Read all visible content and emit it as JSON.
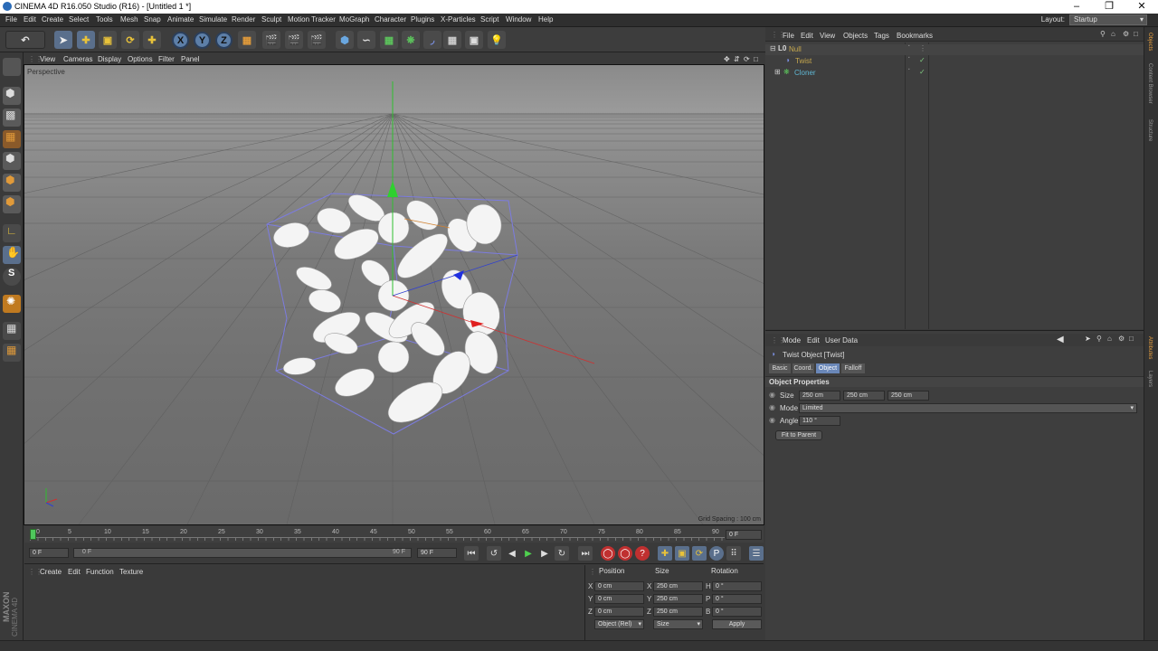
{
  "window": {
    "title": "CINEMA 4D R16.050 Studio (R16) - [Untitled 1 *]"
  },
  "menu": [
    "File",
    "Edit",
    "Create",
    "Select",
    "Tools",
    "Mesh",
    "Snap",
    "Animate",
    "Simulate",
    "Render",
    "Sculpt",
    "Motion Tracker",
    "MoGraph",
    "Character",
    "Plugins",
    "X-Particles",
    "Script",
    "Window",
    "Help"
  ],
  "layout": {
    "label": "Layout:",
    "value": "Startup"
  },
  "toolbar": {
    "axes": [
      "X",
      "Y",
      "Z"
    ]
  },
  "viewport": {
    "menu": [
      "View",
      "Cameras",
      "Display",
      "Options",
      "Filter",
      "Panel"
    ],
    "name": "Perspective",
    "grid_spacing": "Grid Spacing : 100 cm"
  },
  "timeline": {
    "ticks": [
      "0",
      "5",
      "10",
      "15",
      "20",
      "25",
      "30",
      "35",
      "40",
      "45",
      "50",
      "55",
      "60",
      "65",
      "70",
      "75",
      "80",
      "85",
      "90"
    ],
    "current_frame": "0 F",
    "start": "0 F",
    "range_start": "0 F",
    "range_end": "90 F",
    "end": "90 F"
  },
  "material_manager": {
    "menu": [
      "Create",
      "Edit",
      "Function",
      "Texture"
    ]
  },
  "coordinates": {
    "headers": {
      "position": "Position",
      "size": "Size",
      "rotation": "Rotation"
    },
    "rows": [
      {
        "axis": "X",
        "pos": "0 cm",
        "size_axis": "X",
        "size": "250 cm",
        "rot_axis": "H",
        "rot": "0 °"
      },
      {
        "axis": "Y",
        "pos": "0 cm",
        "size_axis": "Y",
        "size": "250 cm",
        "rot_axis": "P",
        "rot": "0 °"
      },
      {
        "axis": "Z",
        "pos": "0 cm",
        "size_axis": "Z",
        "size": "250 cm",
        "rot_axis": "B",
        "rot": "0 °"
      }
    ],
    "mode": "Object (Rel)",
    "size_mode": "Size",
    "apply": "Apply"
  },
  "object_manager": {
    "menu": [
      "File",
      "Edit",
      "View",
      "Objects",
      "Tags",
      "Bookmarks"
    ],
    "objects": [
      {
        "name": "Null",
        "level": 0,
        "color": "#c7a84e"
      },
      {
        "name": "Twist",
        "level": 1,
        "color": "#c7a84e"
      },
      {
        "name": "Cloner",
        "level": 0,
        "color": "#5fb7d4"
      }
    ]
  },
  "attributes": {
    "menu": [
      "Mode",
      "Edit",
      "User Data"
    ],
    "object_title": "Twist Object [Twist]",
    "tabs": [
      "Basic",
      "Coord.",
      "Object",
      "Falloff"
    ],
    "active_tab": "Object",
    "section": "Object Properties",
    "size_label": "Size",
    "size": [
      "250 cm",
      "250 cm",
      "250 cm"
    ],
    "mode_label": "Mode",
    "mode": "Limited",
    "angle_label": "Angle",
    "angle": "110 °",
    "fit_button": "Fit to Parent"
  },
  "side_tabs": [
    "Objects",
    "Content Browser",
    "Structure",
    "Attributes",
    "Layers"
  ],
  "brand": {
    "maxon": "MAXON",
    "product": "CINEMA 4D"
  }
}
